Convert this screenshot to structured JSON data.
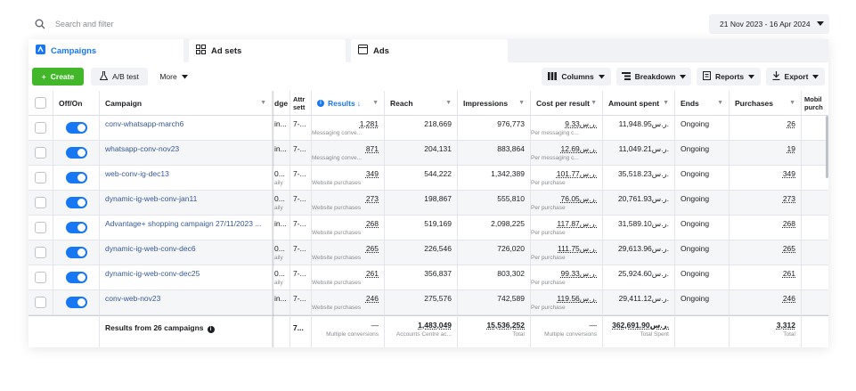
{
  "search": {
    "placeholder": "Search and filter"
  },
  "date_range": "21 Nov 2023 - 16 Apr 2024",
  "tabs": [
    {
      "label": "Campaigns",
      "icon": "campaign-flag-icon"
    },
    {
      "label": "Ad sets",
      "icon": "adsets-grid-icon"
    },
    {
      "label": "Ads",
      "icon": "ad-square-icon"
    }
  ],
  "toolbar": {
    "create": "Create",
    "ab_test": "A/B test",
    "more": "More",
    "columns": "Columns",
    "breakdown": "Breakdown",
    "reports": "Reports",
    "export": "Export"
  },
  "columns": {
    "offon": "Off/On",
    "campaign": "Campaign",
    "budget": "dge",
    "attribution": "Attr\nsett",
    "results": "Results",
    "reach": "Reach",
    "impressions": "Impressions",
    "cost_per_result": "Cost per result",
    "amount_spent": "Amount spent",
    "ends": "Ends",
    "purchases": "Purchases",
    "mobile": "Mobil\npurch"
  },
  "rows": [
    {
      "campaign": "conv-whatsapp-march6",
      "budget": "in...",
      "budget_sub": "",
      "attr": "7-...",
      "results": "1,281",
      "results_sub": "Messaging conve...",
      "reach": "218,669",
      "impressions": "976,773",
      "cpr": "9.33ر.س.",
      "cpr_sub": "Per messaging c...",
      "spent": "11,948.95ر.س.",
      "ends": "Ongoing",
      "purchases": "26"
    },
    {
      "campaign": "whatsapp-conv-nov23",
      "budget": "in...",
      "budget_sub": "",
      "attr": "7-...",
      "results": "871",
      "results_sub": "Messaging conve...",
      "reach": "204,131",
      "impressions": "883,864",
      "cpr": "12.69ر.س.",
      "cpr_sub": "Per messaging c...",
      "spent": "11,049.21ر.س.",
      "ends": "Ongoing",
      "purchases": "19"
    },
    {
      "campaign": "web-conv-ig-dec13",
      "budget": "0...",
      "budget_sub": "aily",
      "attr": "7-...",
      "results": "349",
      "results_sub": "Website purchases",
      "reach": "544,222",
      "impressions": "1,342,389",
      "cpr": "101.77ر.س.",
      "cpr_sub": "Per purchase",
      "spent": "35,518.23ر.س.",
      "ends": "Ongoing",
      "purchases": "349"
    },
    {
      "campaign": "dynamic-ig-web-conv-jan11",
      "budget": "0...",
      "budget_sub": "aily",
      "attr": "7-...",
      "results": "273",
      "results_sub": "Website purchases",
      "reach": "198,867",
      "impressions": "555,810",
      "cpr": "76.05ر.س.",
      "cpr_sub": "Per purchase",
      "spent": "20,761.93ر.س.",
      "ends": "Ongoing",
      "purchases": "273"
    },
    {
      "campaign": "Advantage+ shopping campaign 27/11/2023 ...",
      "budget": "in...",
      "budget_sub": "",
      "attr": "7-...",
      "results": "268",
      "results_sub": "Website purchases",
      "reach": "519,169",
      "impressions": "2,098,225",
      "cpr": "117.87ر.س.",
      "cpr_sub": "Per purchase",
      "spent": "31,589.10ر.س.",
      "ends": "Ongoing",
      "purchases": "268"
    },
    {
      "campaign": "dynamic-ig-web-conv-dec6",
      "budget": "0...",
      "budget_sub": "aily",
      "attr": "7-...",
      "results": "265",
      "results_sub": "Website purchases",
      "reach": "226,546",
      "impressions": "726,020",
      "cpr": "111.75ر.س.",
      "cpr_sub": "Per purchase",
      "spent": "29,613.96ر.س.",
      "ends": "Ongoing",
      "purchases": "265"
    },
    {
      "campaign": "dynamic-ig-web-conv-dec25",
      "budget": "0...",
      "budget_sub": "aily",
      "attr": "7-...",
      "results": "261",
      "results_sub": "Website purchases",
      "reach": "356,837",
      "impressions": "803,302",
      "cpr": "99.33ر.س.",
      "cpr_sub": "Per purchase",
      "spent": "25,924.60ر.س.",
      "ends": "Ongoing",
      "purchases": "261"
    },
    {
      "campaign": "conv-web-nov23",
      "budget": "in...",
      "budget_sub": "",
      "attr": "7-...",
      "results": "246",
      "results_sub": "Website purchases",
      "reach": "275,576",
      "impressions": "742,589",
      "cpr": "119.56ر.س.",
      "cpr_sub": "Per purchase",
      "spent": "29,411.12ر.س.",
      "ends": "Ongoing",
      "purchases": "246"
    }
  ],
  "totals": {
    "label": "Results from 26 campaigns",
    "attr": "7...",
    "results": "—",
    "results_sub": "Multiple conversions",
    "reach": "1,483,049",
    "reach_sub": "Accounts Centre ac...",
    "impressions": "15,536,252",
    "impressions_sub": "Total",
    "cpr": "—",
    "cpr_sub": "Multiple conversions",
    "spent": "362,691.90ر.س.",
    "spent_sub": "Total Spent",
    "purchases": "3,312",
    "purchases_sub": "Total"
  },
  "colors": {
    "accent": "#1877f2",
    "create": "#42b72a",
    "link": "#385898"
  }
}
